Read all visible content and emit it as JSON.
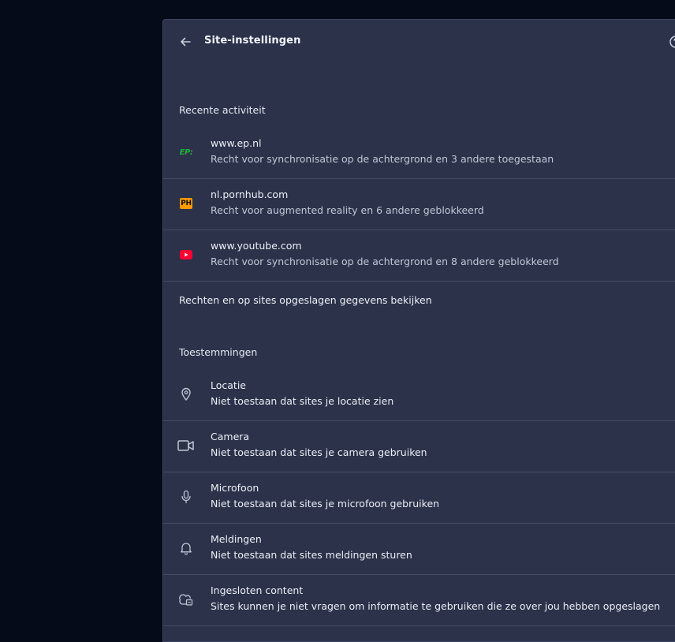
{
  "header": {
    "title": "Site-instellingen",
    "back_icon": "arrow-left-icon",
    "help_icon": "help-circle-icon"
  },
  "recent": {
    "label": "Recente activiteit",
    "items": [
      {
        "site": "www.ep.nl",
        "status": "Recht voor synchronisatie op de achtergrond en 3 andere toegestaan",
        "icon": "ep-favicon",
        "icon_text": "EP:"
      },
      {
        "site": "nl.pornhub.com",
        "status": "Recht voor augmented reality en 6 andere geblokkeerd",
        "icon": "pornhub-favicon",
        "icon_text": "PH"
      },
      {
        "site": "www.youtube.com",
        "status": "Recht voor synchronisatie op de achtergrond en 8 andere geblokkeerd",
        "icon": "youtube-favicon"
      }
    ],
    "view_all": "Rechten en op sites opgeslagen gegevens bekijken"
  },
  "permissions": {
    "label": "Toestemmingen",
    "items": [
      {
        "name": "Locatie",
        "status": "Niet toestaan dat sites je locatie zien",
        "icon": "location-pin-icon"
      },
      {
        "name": "Camera",
        "status": "Niet toestaan dat sites je camera gebruiken",
        "icon": "camera-icon"
      },
      {
        "name": "Microfoon",
        "status": "Niet toestaan dat sites je microfoon gebruiken",
        "icon": "microphone-icon"
      },
      {
        "name": "Meldingen",
        "status": "Niet toestaan dat sites meldingen sturen",
        "icon": "bell-icon"
      },
      {
        "name": "Ingesloten content",
        "status": "Sites kunnen je niet vragen om informatie te gebruiken die ze over jou hebben opgeslagen",
        "icon": "embedded-content-icon"
      }
    ]
  },
  "colors": {
    "background": "#060b1a",
    "panel": "#2b324a",
    "divider": "#444c66",
    "youtube_red": "#ff0033",
    "ep_green": "#1fae3b",
    "ph_orange": "#ff9a00"
  }
}
